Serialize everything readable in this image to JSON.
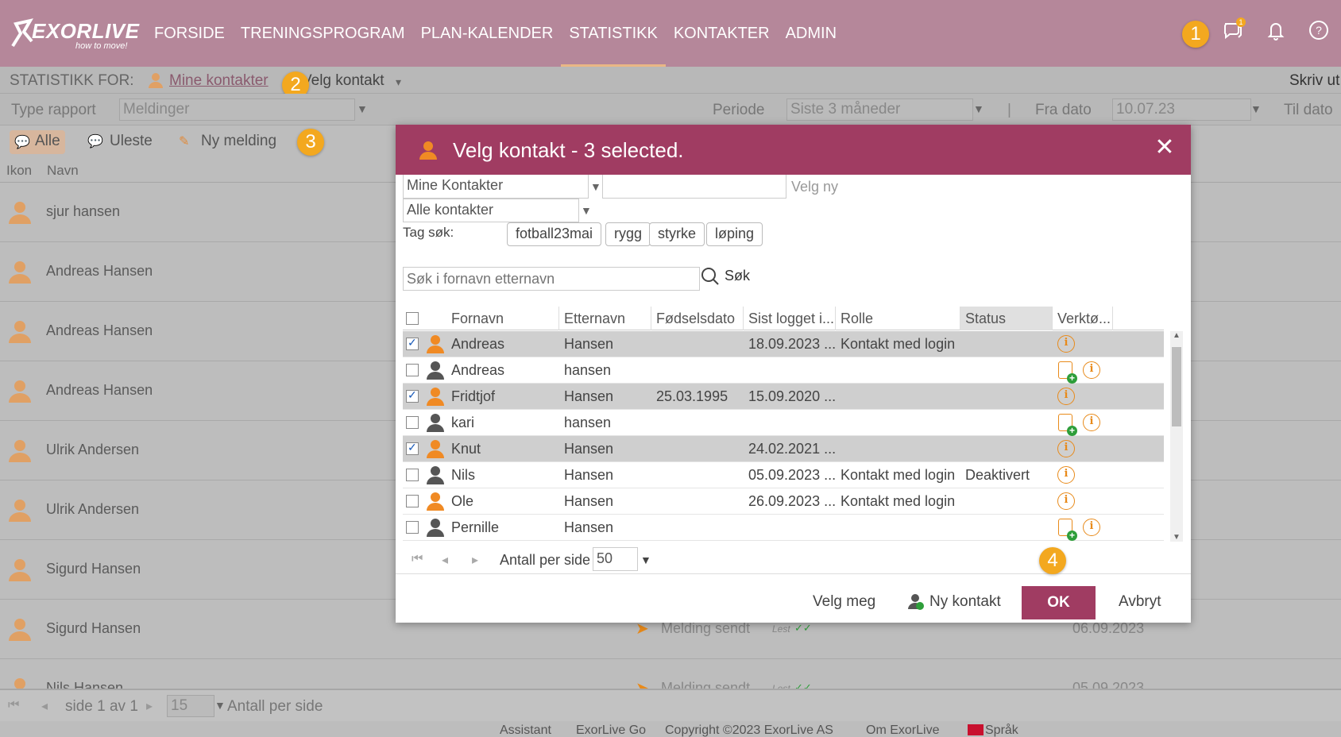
{
  "brand": {
    "name": "EXORLIVE",
    "tagline": "how to move!"
  },
  "nav": [
    "FORSIDE",
    "TRENINGSPROGRAM",
    "PLAN-KALENDER",
    "STATISTIKK",
    "KONTAKTER",
    "ADMIN"
  ],
  "nav_active": "STATISTIKK",
  "top_icons": {
    "chat_badge": "1"
  },
  "markers": [
    "1",
    "2",
    "3",
    "4"
  ],
  "stats_for": {
    "label": "STATISTIKK FOR:",
    "contacts_link": "Mine kontakter",
    "choose": "Velg kontakt",
    "print": "Skriv ut"
  },
  "filters": {
    "type_label": "Type rapport",
    "type_value": "Meldinger",
    "period_label": "Periode",
    "period_value": "Siste 3 måneder",
    "separator": "|",
    "from_label": "Fra dato",
    "from_value": "10.07.23",
    "to_label": "Til dato"
  },
  "tabs": {
    "all": "Alle",
    "unread": "Uleste",
    "new": "Ny melding"
  },
  "list_headers": {
    "icon": "Ikon",
    "name": "Navn"
  },
  "list": [
    "sjur hansen",
    "Andreas Hansen",
    "Andreas Hansen",
    "Andreas Hansen",
    "Ulrik Andersen",
    "Ulrik Andersen",
    "Sigurd Hansen",
    "Sigurd Hansen",
    "Nils Hansen"
  ],
  "message_rows": [
    {
      "status": "Melding sendt",
      "read": "Lest",
      "date": "06.09.2023"
    },
    {
      "status": "Melding sendt",
      "read": "Lest",
      "date": "05.09.2023"
    }
  ],
  "bottom": {
    "page": "side 1 av 1",
    "per_page_value": "15",
    "per_page_label": "Antall per side"
  },
  "footer": [
    "Assistant",
    "ExorLive Go",
    "Copyright ©2023 ExorLive AS",
    "Om ExorLive",
    "Språk"
  ],
  "modal": {
    "title": "Velg kontakt - 3 selected.",
    "filter1": "Mine Kontakter",
    "new_placeholder": "Velg ny",
    "filter2": "Alle kontakter",
    "tag_label": "Tag søk:",
    "tags": [
      "fotball23mai",
      "rygg",
      "styrke",
      "løping"
    ],
    "search_placeholder": "Søk i fornavn etternavn",
    "search_button": "Søk",
    "columns": [
      "Fornavn",
      "Etternavn",
      "Fødselsdato",
      "Sist logget i...",
      "Rolle",
      "Status",
      "Verktø..."
    ],
    "rows": [
      {
        "first": "Andreas",
        "last": "Hansen",
        "dob": "",
        "last_login": "18.09.2023 ...",
        "role": "Kontakt med login",
        "status": "",
        "checked": true,
        "orange": true,
        "add": false
      },
      {
        "first": "Andreas",
        "last": "hansen",
        "dob": "",
        "last_login": "",
        "role": "",
        "status": "",
        "checked": false,
        "orange": false,
        "add": true
      },
      {
        "first": "Fridtjof",
        "last": "Hansen",
        "dob": "25.03.1995",
        "last_login": "15.09.2020 ...",
        "role": "",
        "status": "",
        "checked": true,
        "orange": true,
        "add": false
      },
      {
        "first": "kari",
        "last": "hansen",
        "dob": "",
        "last_login": "",
        "role": "",
        "status": "",
        "checked": false,
        "orange": false,
        "add": true
      },
      {
        "first": "Knut",
        "last": "Hansen",
        "dob": "",
        "last_login": "24.02.2021 ...",
        "role": "",
        "status": "",
        "checked": true,
        "orange": true,
        "add": false
      },
      {
        "first": "Nils",
        "last": "Hansen",
        "dob": "",
        "last_login": "05.09.2023 ...",
        "role": "Kontakt med login",
        "status": "Deaktivert",
        "checked": false,
        "orange": false,
        "add": false
      },
      {
        "first": "Ole",
        "last": "Hansen",
        "dob": "",
        "last_login": "26.09.2023 ...",
        "role": "Kontakt med login",
        "status": "",
        "checked": false,
        "orange": true,
        "add": false
      },
      {
        "first": "Pernille",
        "last": "Hansen",
        "dob": "",
        "last_login": "",
        "role": "",
        "status": "",
        "checked": false,
        "orange": false,
        "add": true
      }
    ],
    "pager": {
      "label": "Antall per side",
      "value": "50"
    },
    "buttons": {
      "me": "Velg meg",
      "new_contact": "Ny kontakt",
      "ok": "OK",
      "cancel": "Avbryt"
    }
  },
  "colors": {
    "topbar": "#b5879a",
    "accent": "#a03c62",
    "orange": "#f08a24",
    "badge": "#f3a81f"
  }
}
